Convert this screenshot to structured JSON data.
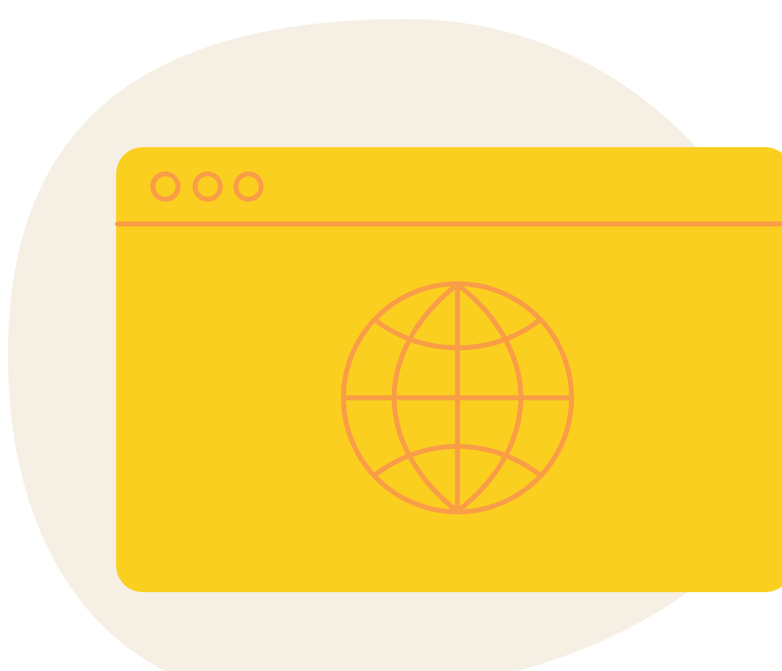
{
  "illustration": {
    "subject": "browser-window-globe",
    "icons": [
      "window-dot-icon",
      "window-dot-icon",
      "window-dot-icon",
      "globe-icon"
    ],
    "colors": {
      "page_background": "#ffffff",
      "blob": "#f5efe4",
      "window_fill": "#fbcf1f",
      "line_accent": "#f99d47"
    }
  }
}
